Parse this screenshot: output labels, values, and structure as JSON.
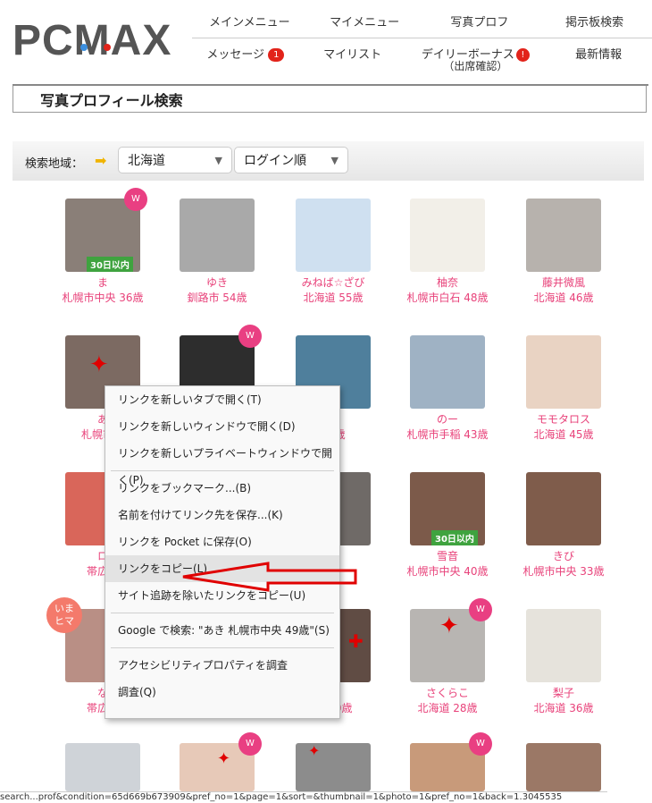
{
  "logo": "PCMAX",
  "colors": {
    "accent": "#e8427a",
    "badge": "#e2231a"
  },
  "nav_top": [
    "メインメニュー",
    "マイメニュー",
    "写真プロフ",
    "掲示板検索"
  ],
  "nav_bottom": {
    "message": "メッセージ",
    "message_count": "1",
    "mylist": "マイリスト",
    "daily": "デイリーボーナス",
    "daily_sub": "（出席確認）",
    "daily_badge": "!",
    "news": "最新情報"
  },
  "page_title": "写真プロフィール検索",
  "filter": {
    "label": "検索地域：",
    "region": "北海道",
    "sort": "ログイン順"
  },
  "profiles": [
    {
      "name": "ま",
      "meta": "札幌市中央 36歳",
      "w": true,
      "days": "30日以内"
    },
    {
      "name": "ゆき",
      "meta": "釧路市 54歳"
    },
    {
      "name": "みねば☆ざび",
      "meta": "北海道 55歳"
    },
    {
      "name": "柚奈",
      "meta": "札幌市白石 48歳"
    },
    {
      "name": "藤井微風",
      "meta": "北海道 46歳"
    },
    {
      "name": "あ",
      "meta": "札幌市中",
      "cut": true
    },
    {
      "name": "",
      "meta": "",
      "w": true,
      "hidden": true
    },
    {
      "name": "き",
      "meta": "49歳",
      "cut": true
    },
    {
      "name": "のー",
      "meta": "札幌市手稲 43歳"
    },
    {
      "name": "モモタロス",
      "meta": "北海道 45歳"
    },
    {
      "name": "ロ",
      "meta": "帯広市",
      "cut": true
    },
    {
      "name": "",
      "meta": "",
      "hidden": true
    },
    {
      "name": "こ",
      "meta": "歳",
      "cut": true
    },
    {
      "name": "雪音",
      "meta": "札幌市中央 40歳",
      "days": "30日以内"
    },
    {
      "name": "きび",
      "meta": "札幌市中央 33歳"
    },
    {
      "name": "な",
      "meta": "帯広市",
      "cut": true
    },
    {
      "name": "",
      "meta": "",
      "hidden": true
    },
    {
      "name": "な",
      "meta": "石 40歳",
      "cut": true
    },
    {
      "name": "さくらこ",
      "meta": "北海道 28歳",
      "w": true
    },
    {
      "name": "梨子",
      "meta": "北海道 36歳"
    },
    {
      "name": "",
      "meta": "",
      "bottom": true
    },
    {
      "name": "",
      "meta": "",
      "bottom": true,
      "w": true
    },
    {
      "name": "",
      "meta": "",
      "bottom": true
    },
    {
      "name": "",
      "meta": "",
      "bottom": true,
      "w": true
    },
    {
      "name": "",
      "meta": "",
      "bottom": true
    }
  ],
  "ima_badge": {
    "l1": "いま",
    "l2": "ヒマ"
  },
  "context_menu": [
    "リンクを新しいタブで開く(T)",
    "リンクを新しいウィンドウで開く(D)",
    "リンクを新しいプライベートウィンドウで開く(P)",
    "リンクをブックマーク...(B)",
    "名前を付けてリンク先を保存...(K)",
    "リンクを Pocket に保存(O)",
    "リンクをコピー(L)",
    "サイト追跡を除いたリンクをコピー(U)",
    "Google で検索: \"あき 札幌市中央 49歳\"(S)",
    "アクセシビリティプロパティを調査",
    "調査(Q)"
  ],
  "status_url": "search...prof&condition=65d669b673909&pref_no=1&page=1&sort=&thumbnail=1&photo=1&pref_no=1&back=1.3045535"
}
